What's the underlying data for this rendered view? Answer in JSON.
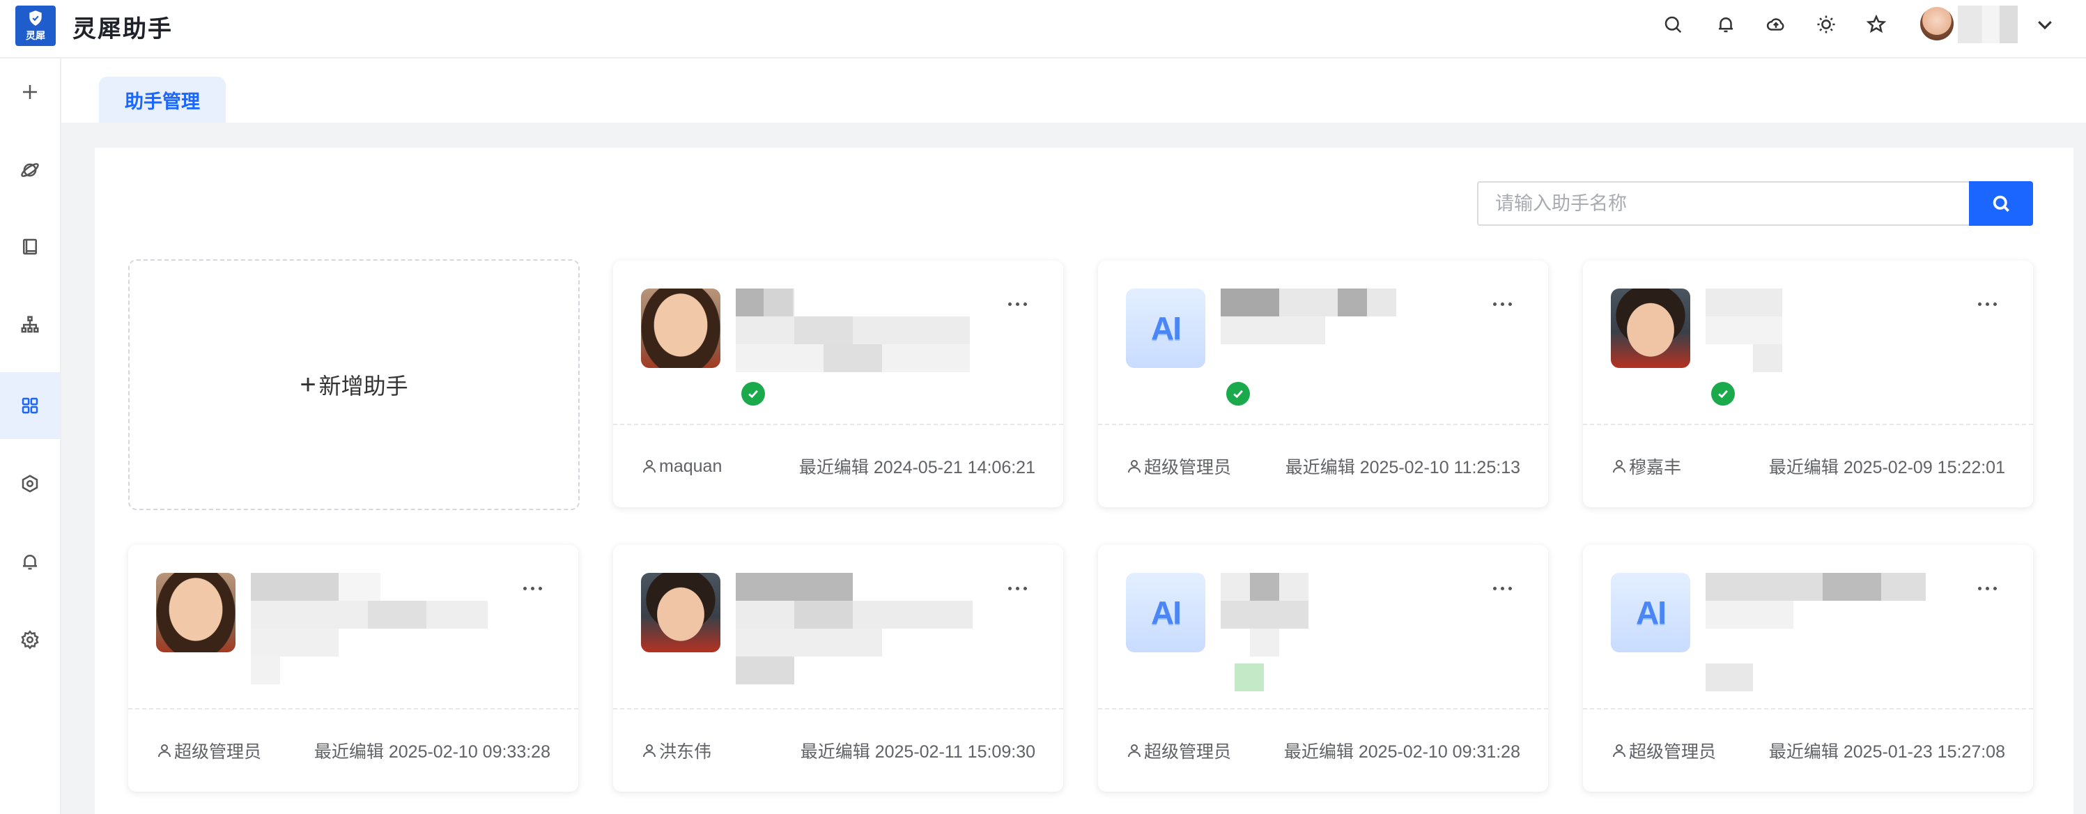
{
  "app": {
    "title": "灵犀助手",
    "logo_text": "灵犀"
  },
  "header": {
    "icons": [
      "search-icon",
      "bell-icon",
      "cloud-upload-icon",
      "sun-icon",
      "star-icon"
    ]
  },
  "sidebar": {
    "items": [
      "plus-icon",
      "planet-icon",
      "book-icon",
      "org-tree-icon",
      "apps-grid-icon",
      "hexagon-settings-icon",
      "bell-icon",
      "gear-icon"
    ],
    "active_index": 4
  },
  "tabs": [
    {
      "label": "助手管理"
    }
  ],
  "search": {
    "placeholder": "请输入助手名称"
  },
  "add_card": {
    "plus": "+",
    "label": "新增助手"
  },
  "cards": [
    {
      "avatar": "girl",
      "status": "published",
      "owner": "maquan",
      "edited": "最近编辑 2024-05-21 14:06:21"
    },
    {
      "avatar": "ai",
      "avatar_text": "AI",
      "status": "published",
      "owner": "超级管理员",
      "edited": "最近编辑 2025-02-10 11:25:13"
    },
    {
      "avatar": "boy",
      "status": "published",
      "owner": "穆嘉丰",
      "edited": "最近编辑 2025-02-09 15:22:01"
    },
    {
      "avatar": "girl",
      "status": "none",
      "owner": "超级管理员",
      "edited": "最近编辑 2025-02-10 09:33:28"
    },
    {
      "avatar": "boy",
      "status": "none",
      "owner": "洪东伟",
      "edited": "最近编辑 2025-02-11 15:09:30"
    },
    {
      "avatar": "ai",
      "avatar_text": "AI",
      "status": "pending",
      "owner": "超级管理员",
      "edited": "最近编辑 2025-02-10 09:31:28"
    },
    {
      "avatar": "ai",
      "avatar_text": "AI",
      "status": "none",
      "owner": "超级管理员",
      "edited": "最近编辑 2025-01-23 15:27:08"
    }
  ],
  "colors": {
    "accent": "#1a66ff",
    "success": "#1aaa4c",
    "tab_bg": "#e8f0fe",
    "content_bg": "#f2f3f5"
  }
}
